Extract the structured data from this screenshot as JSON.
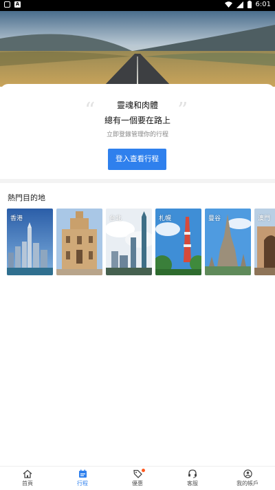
{
  "statusbar": {
    "time": "6:01"
  },
  "card": {
    "line1": "靈魂和肉體",
    "line2": "總有一個要在路上",
    "subtitle": "立即登錄管理你的行程",
    "login_button": "登入查看行程",
    "quote_open": "“",
    "quote_close": "”"
  },
  "section": {
    "title": "熱門目的地"
  },
  "destinations": [
    {
      "label": "香港"
    },
    {
      "label": ""
    },
    {
      "label": "台北"
    },
    {
      "label": "札幌"
    },
    {
      "label": "曼谷"
    },
    {
      "label": "澳門"
    }
  ],
  "nav": {
    "items": [
      {
        "label": "首頁",
        "icon": "home-icon"
      },
      {
        "label": "行程",
        "icon": "itinerary-icon"
      },
      {
        "label": "優惠",
        "icon": "discount-tag-icon"
      },
      {
        "label": "客服",
        "icon": "headset-icon"
      },
      {
        "label": "我的帳戶",
        "icon": "user-icon"
      }
    ],
    "active": "行程"
  },
  "colors": {
    "accent": "#2f80ed",
    "badge": "#ff5a1f"
  }
}
